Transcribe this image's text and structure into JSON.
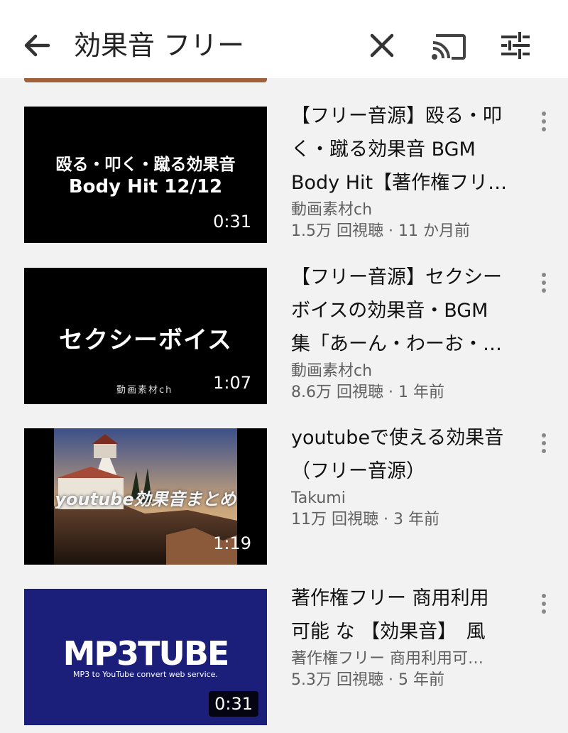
{
  "search": {
    "query": "効果音 フリー"
  },
  "header": {
    "back_icon": "arrow-left-icon",
    "clear_icon": "close-icon",
    "cast_icon": "cast-icon",
    "filter_icon": "filter-sliders-icon"
  },
  "results": [
    {
      "thumb_lines": [
        "殴る・叩く・蹴る効果音",
        "Body Hit 12/12"
      ],
      "duration": "0:31",
      "title_lines": [
        "【フリー音源】殴る・叩",
        "く・蹴る効果音 BGM",
        "Body Hit【著作権フリ…"
      ],
      "channel": "動画素材ch",
      "stats": "1.5万 回視聴 · 11 か月前"
    },
    {
      "thumb_lines": [
        "セクシーボイス"
      ],
      "thumb_brand": "動画素材ch",
      "duration": "1:07",
      "title_lines": [
        "【フリー音源】セクシー",
        "ボイスの効果音・BGM",
        "集「あーん・わーお・…"
      ],
      "channel": "動画素材ch",
      "stats": "8.6万 回視聴 · 1 年前"
    },
    {
      "thumb_lines": [
        "youtube効果音まとめ"
      ],
      "duration": "1:19",
      "title_lines": [
        "youtubeで使える効果音",
        "（フリー音源）"
      ],
      "channel": "Takumi",
      "stats": "11万 回視聴 · 3 年前"
    },
    {
      "thumb_lines": [
        "MP3TUBE",
        "MP3 to YouTube convert web service."
      ],
      "duration": "0:31",
      "title_lines": [
        "著作権フリー 商用利用",
        "可能 な 【効果音】　風"
      ],
      "channel": "著作権フリー 商用利用可…",
      "stats": "5.3万 回視聴 · 5 年前"
    }
  ],
  "colors": {
    "background": "#f2f2f2",
    "topbar": "#ffffff",
    "mp3tube_bg": "#1c1f7a",
    "secondary_text": "#606060"
  }
}
